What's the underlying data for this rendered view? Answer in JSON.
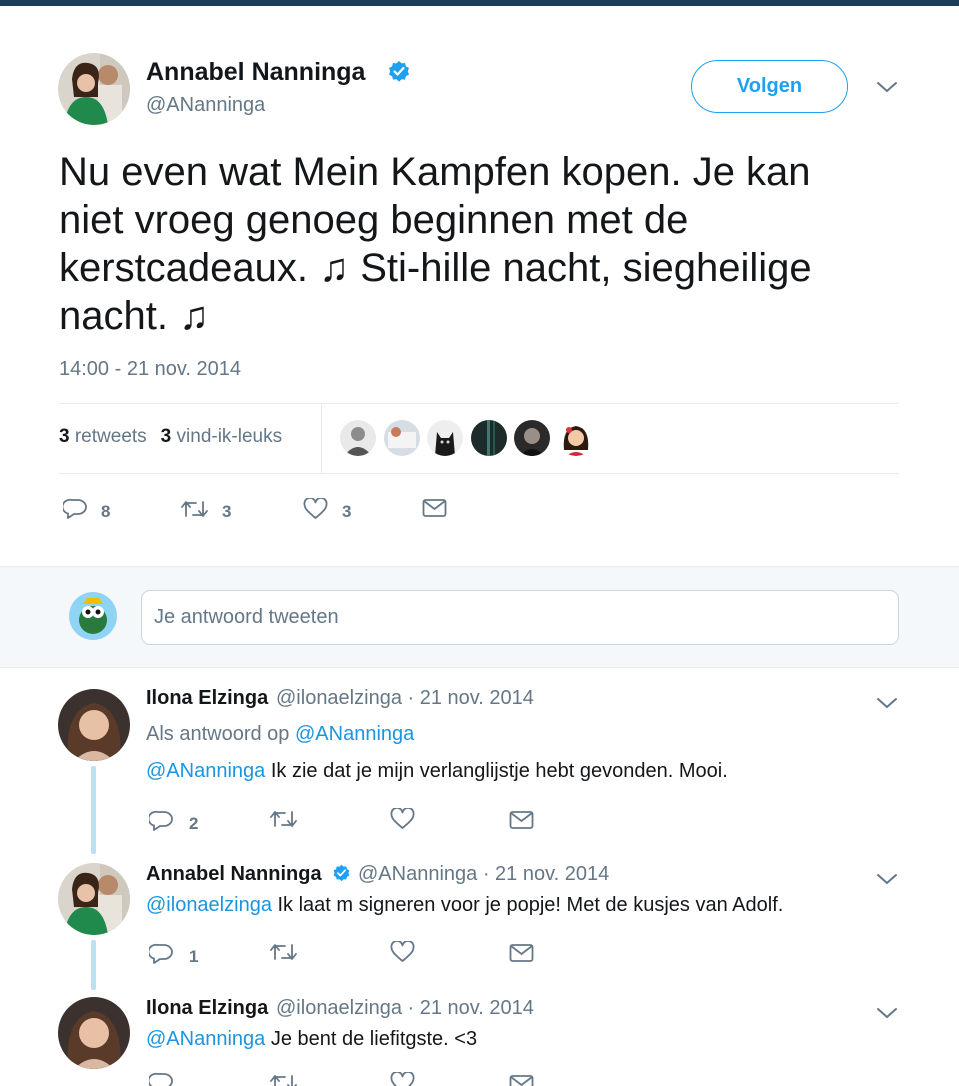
{
  "tweet": {
    "author_name": "Annabel Nanninga",
    "author_handle": "@ANanninga",
    "follow_label": "Volgen",
    "text_parts": [
      "Nu even wat Mein Kampfen kopen. Je kan niet vroeg genoeg beginnen met de kerstcadeaux. ",
      "♫",
      " Sti-hille nacht, siegheilige nacht. ",
      "♫"
    ],
    "timestamp": "14:00 - 21 nov. 2014",
    "retweet_count": "3",
    "retweet_label": "retweets",
    "like_count": "3",
    "like_label": "vind-ik-leuks",
    "reply_action_count": "8",
    "retweet_action_count": "3",
    "like_action_count": "3"
  },
  "reply_box": {
    "placeholder": "Je antwoord tweeten"
  },
  "replies": [
    {
      "name": "Ilona Elzinga",
      "handle": "@ilonaelzinga",
      "date": " · 21 nov. 2014",
      "reply_to_prefix": "Als antwoord op ",
      "reply_to_handle": "@ANanninga",
      "mention": "@ANanninga",
      "text": " Ik zie dat je mijn verlanglijstje hebt gevonden. Mooi.",
      "reply_count": "2"
    },
    {
      "name": "Annabel Nanninga",
      "handle": "@ANanninga",
      "date": " · 21 nov. 2014",
      "mention": "@ilonaelzinga",
      "text": " Ik laat m signeren voor je popje! Met de kusjes van Adolf.",
      "reply_count": "1"
    },
    {
      "name": "Ilona Elzinga",
      "handle": "@ilonaelzinga",
      "date": " · 21 nov. 2014",
      "mention": "@ANanninga",
      "text": " Je bent de liefitgste. <3"
    }
  ],
  "colors": {
    "accent": "#1da1f2",
    "link": "#1b95e0",
    "muted": "#657786",
    "text": "#14171a",
    "thread": "#bde0f2"
  },
  "icons": [
    "verified-icon",
    "chevron-down-icon",
    "reply-icon",
    "retweet-icon",
    "heart-icon",
    "mail-icon"
  ]
}
